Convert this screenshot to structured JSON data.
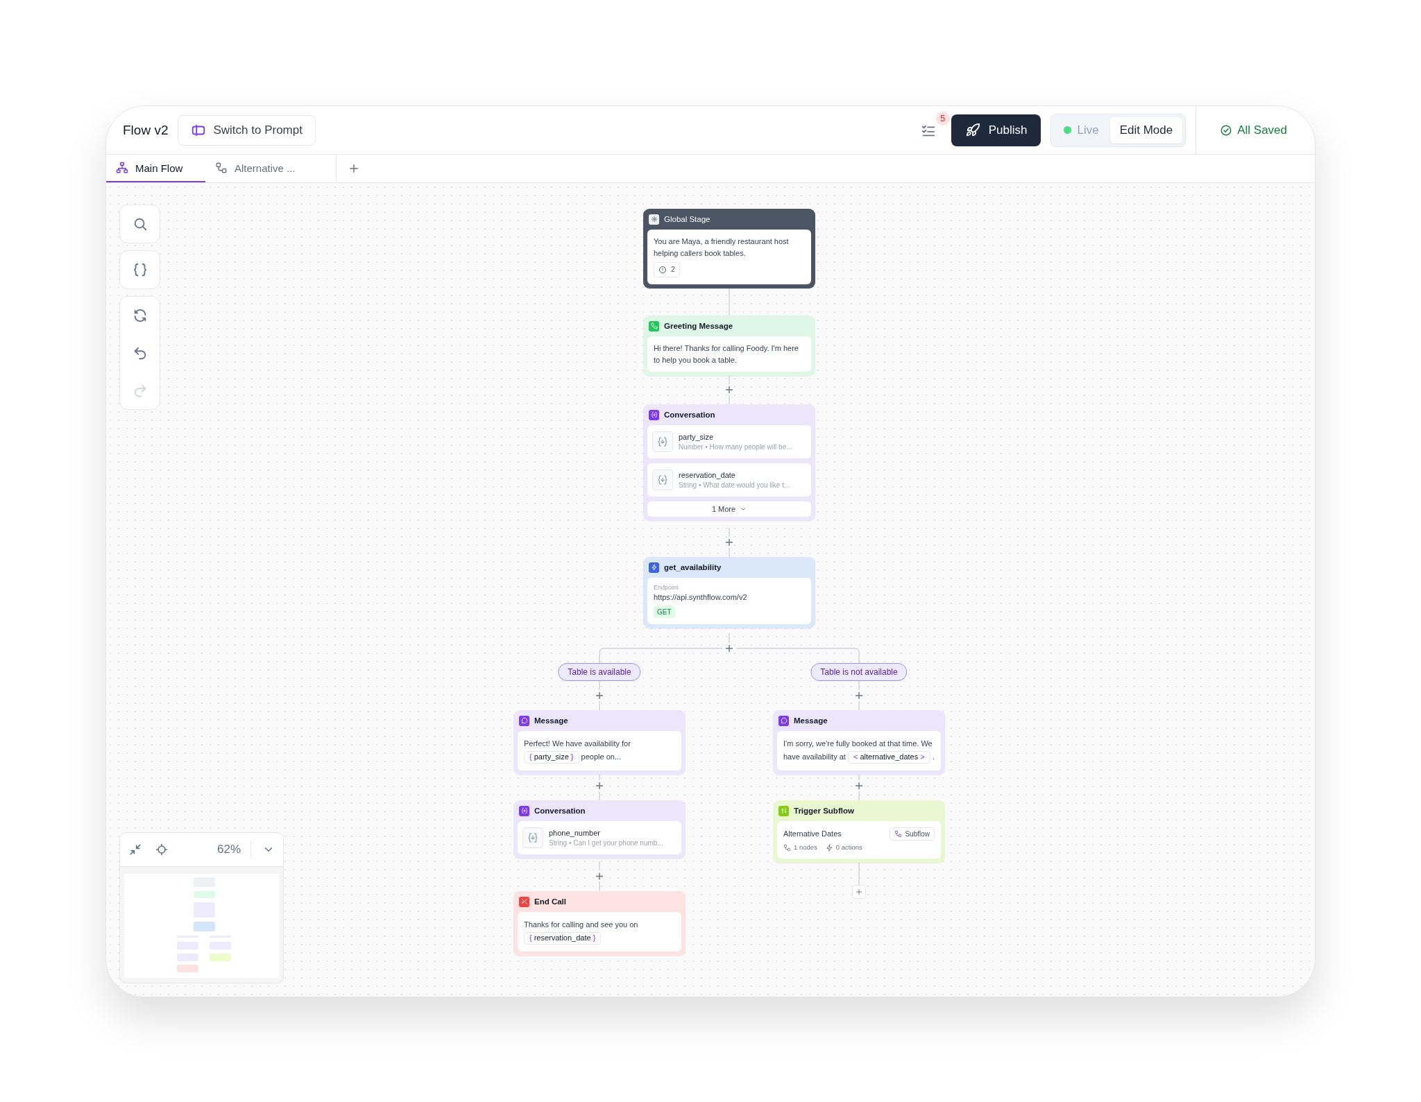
{
  "header": {
    "title": "Flow v2",
    "switch_button": "Switch to Prompt",
    "tasks_badge": "5",
    "publish_button": "Publish",
    "mode_toggle": [
      {
        "label": "Live",
        "selected": false
      },
      {
        "label": "Edit Mode",
        "selected": true
      }
    ],
    "save_status": "All Saved"
  },
  "tabs": [
    {
      "label": "Main Flow",
      "selected": true
    },
    {
      "label": "Alternative ...",
      "selected": false
    }
  ],
  "toolbar": [
    {
      "kind": "search",
      "disabled": false
    },
    {
      "kind": "variables",
      "disabled": false
    },
    {
      "kind": "refresh",
      "disabled": false
    },
    {
      "kind": "undo",
      "disabled": false
    },
    {
      "kind": "redo",
      "disabled": true
    }
  ],
  "zoom": {
    "reading": "62%"
  },
  "nodes": [
    {
      "kind": "global",
      "title": "Global Stage",
      "text": "You are Maya, a friendly restaurant host helping callers book tables.",
      "count": "2"
    },
    {
      "kind": "greeting",
      "title": "Greeting Message",
      "text": "Hi there! Thanks for calling Foody. I'm here to help you book a table."
    },
    {
      "kind": "conversation",
      "title": "Conversation",
      "variables": [
        {
          "name": "party_size",
          "detail": "Number • How many people will be..."
        },
        {
          "name": "reservation_date",
          "detail": "String • What date would you like t..."
        }
      ],
      "more": "1 More"
    },
    {
      "kind": "api",
      "title": "get_availability",
      "label": "Endpoint",
      "url": "https://api.synthflow.com/v2",
      "method": "GET"
    }
  ],
  "branches": [
    {
      "label": "Table is available",
      "nodes": [
        {
          "kind": "message",
          "title": "Message",
          "parts": [
            {
              "kind": "text",
              "text": "Perfect! We have availability for"
            },
            {
              "kind": "variable",
              "open": "{",
              "name": "party_size",
              "close": "}"
            },
            {
              "kind": "text",
              "text": "people on..."
            }
          ]
        },
        {
          "kind": "conversation",
          "title": "Conversation",
          "variables": [
            {
              "name": "phone_number",
              "detail": "String • Can I get your phone numb..."
            }
          ]
        },
        {
          "kind": "end",
          "title": "End Call",
          "parts": [
            {
              "kind": "text",
              "text": "Thanks for calling and see you on"
            },
            {
              "kind": "variable",
              "open": "{",
              "name": "reservation_date",
              "close": "}"
            }
          ]
        }
      ]
    },
    {
      "label": "Table is not available",
      "nodes": [
        {
          "kind": "message",
          "title": "Message",
          "parts": [
            {
              "kind": "text",
              "text": "I'm sorry, we're fully booked at that time. We have availability at"
            },
            {
              "kind": "variable",
              "open": "<",
              "name": "alternative_dates",
              "close": ">"
            },
            {
              "kind": "text",
              "text": "."
            }
          ]
        },
        {
          "kind": "subflow",
          "title": "Trigger Subflow",
          "name": "Alternative Dates",
          "badge": "Subflow",
          "nodes_count": "1 nodes",
          "actions_count": "0 actions"
        }
      ]
    }
  ]
}
